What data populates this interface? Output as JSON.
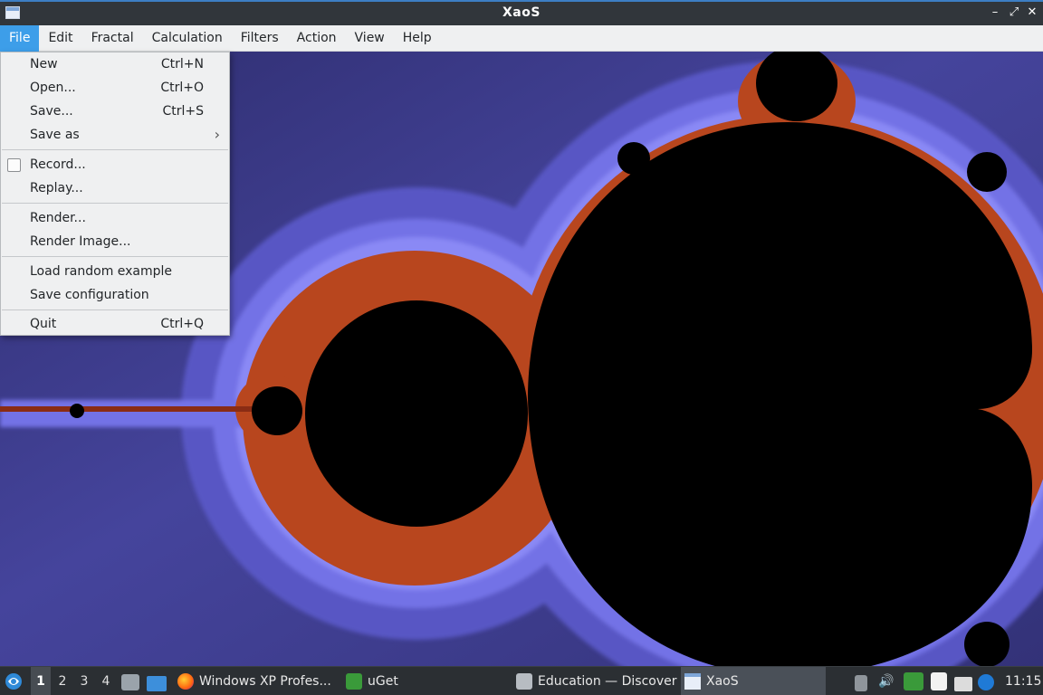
{
  "window": {
    "title": "XaoS"
  },
  "menubar": {
    "items": [
      "File",
      "Edit",
      "Fractal",
      "Calculation",
      "Filters",
      "Action",
      "View",
      "Help"
    ],
    "active": "File"
  },
  "file_menu": {
    "new": {
      "label": "New",
      "shortcut": "Ctrl+N"
    },
    "open": {
      "label": "Open...",
      "shortcut": "Ctrl+O"
    },
    "save": {
      "label": "Save...",
      "shortcut": "Ctrl+S"
    },
    "save_as": {
      "label": "Save as"
    },
    "record": {
      "label": "Record...",
      "checked": false
    },
    "replay": {
      "label": "Replay..."
    },
    "render": {
      "label": "Render..."
    },
    "render_image": {
      "label": "Render Image..."
    },
    "load_random": {
      "label": "Load random example"
    },
    "save_config": {
      "label": "Save configuration"
    },
    "quit": {
      "label": "Quit",
      "shortcut": "Ctrl+Q"
    }
  },
  "taskbar": {
    "workspaces": [
      "1",
      "2",
      "3",
      "4"
    ],
    "active_workspace": "1",
    "tasks": {
      "firefox": "Windows XP Profes...",
      "uget": "uGet",
      "discover": "Education — Discover",
      "xaos": "XaoS"
    },
    "clock": "11:15"
  },
  "colors": {
    "titlebar": "#31363b",
    "menu_highlight": "#3d9ee9",
    "fractal_inner": "#000000",
    "fractal_blue_light": "#7d7cf0",
    "fractal_blue_dark": "#3d3c8e",
    "fractal_edge": "#b8461e"
  }
}
